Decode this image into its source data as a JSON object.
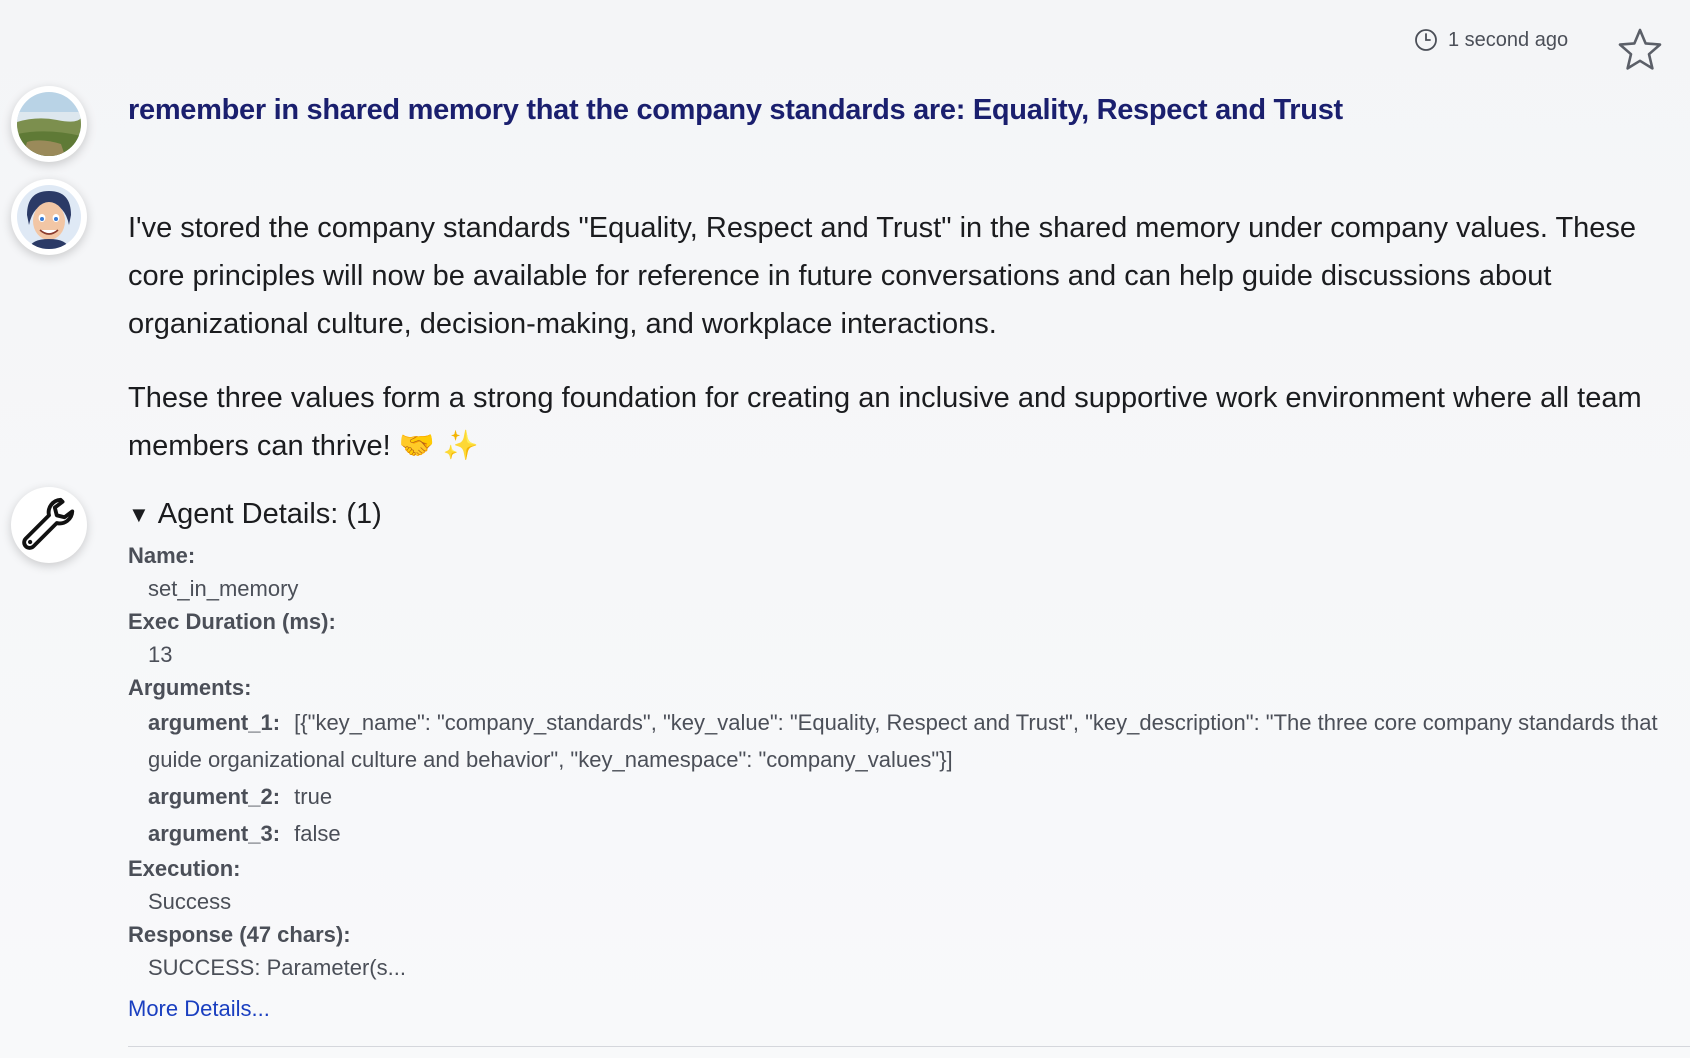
{
  "header": {
    "timestamp": "1 second ago",
    "clock_icon": "clock-icon",
    "star_icon": "star-icon"
  },
  "user_message": {
    "text": "remember in shared memory that the company standards are: Equality, Respect and Trust"
  },
  "assistant_message": {
    "paragraphs": [
      "I've stored the company standards \"Equality, Respect and Trust\" in the shared memory under company values. These core principles will now be available for reference in future conversations and can help guide discussions about organizational culture, decision-making, and workplace interactions.",
      "These three values form a strong foundation for creating an inclusive and supportive work environment where all team members can thrive! 🤝 ✨"
    ]
  },
  "agent_details": {
    "summary": "Agent Details: (1)",
    "name_label": "Name:",
    "name_value": "set_in_memory",
    "duration_label": "Exec Duration (ms):",
    "duration_value": "13",
    "arguments_label": "Arguments:",
    "arguments": [
      {
        "name": "argument_1:",
        "value": "[{\"key_name\": \"company_standards\", \"key_value\": \"Equality, Respect and Trust\", \"key_description\": \"The three core company standards that guide organizational culture and behavior\", \"key_namespace\": \"company_values\"}]"
      },
      {
        "name": "argument_2:",
        "value": "true"
      },
      {
        "name": "argument_3:",
        "value": "false"
      }
    ],
    "execution_label": "Execution:",
    "execution_value": "Success",
    "response_label": "Response (47 chars):",
    "response_value": "SUCCESS: Parameter(s...",
    "more_link": "More Details..."
  },
  "colors": {
    "user_text": "#1a1f6e",
    "link": "#1a3fc0",
    "muted": "#4b4f58"
  }
}
